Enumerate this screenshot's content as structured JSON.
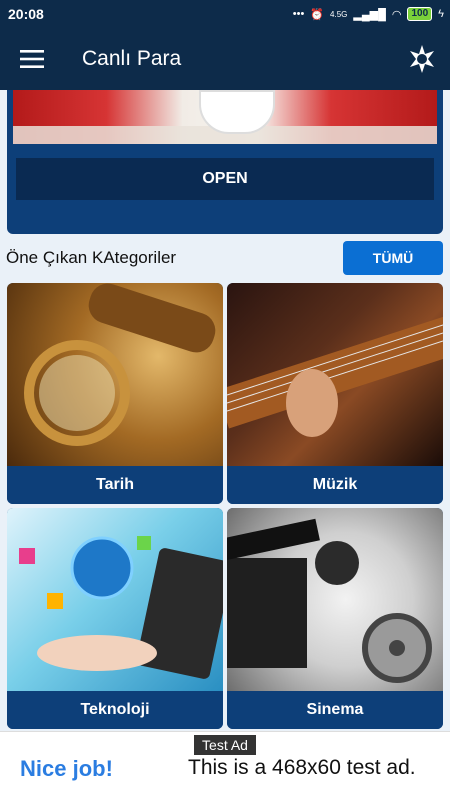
{
  "status_bar": {
    "time": "20:08",
    "network": "4.5G",
    "battery": "100"
  },
  "app_bar": {
    "title": "Canlı Para",
    "menu_icon": "hamburger-icon",
    "theme_icon": "brightness-icon"
  },
  "promo": {
    "open_label": "OPEN"
  },
  "featured": {
    "title": "Öne Çıkan KAtegoriler",
    "all_label": "TÜMÜ",
    "categories": [
      {
        "label": "Tarih"
      },
      {
        "label": "Müzik"
      },
      {
        "label": "Teknoloji"
      },
      {
        "label": "Sinema"
      }
    ]
  },
  "ad": {
    "tag": "Test Ad",
    "nice": "Nice job!",
    "text": "This is a 468x60 test ad."
  },
  "colors": {
    "primary_dark": "#0d2b4a",
    "card_blue": "#0d3f79",
    "accent_blue": "#0b6fd3",
    "background": "#eaf1f8"
  }
}
